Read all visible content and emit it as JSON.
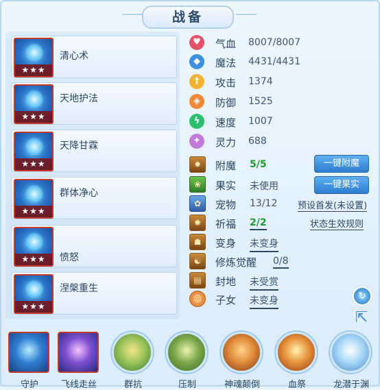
{
  "title": "战备",
  "skills": [
    {
      "name": "清心术",
      "stars": "★★★"
    },
    {
      "name": "天地护法",
      "stars": "★★★"
    },
    {
      "name": "天降甘霖",
      "stars": "★★★"
    },
    {
      "name": "群体净心",
      "stars": "★★★"
    },
    {
      "name": "愤怒",
      "stars": "★★★"
    },
    {
      "name": "涅槃重生",
      "stars": "★★★"
    }
  ],
  "stats": [
    {
      "label": "气血",
      "value": "8007/8007",
      "icon": "heart-icon",
      "color": "#e2536b"
    },
    {
      "label": "魔法",
      "value": "4431/4431",
      "icon": "mana-icon",
      "color": "#3d8fe0"
    },
    {
      "label": "攻击",
      "value": "1374",
      "icon": "sword-icon",
      "color": "#f0b331"
    },
    {
      "label": "防御",
      "value": "1525",
      "icon": "shield-icon",
      "color": "#f08a3a"
    },
    {
      "label": "速度",
      "value": "1007",
      "icon": "lightning-icon",
      "color": "#2cbf6e"
    },
    {
      "label": "灵力",
      "value": "688",
      "icon": "spirit-icon",
      "color": "#c07ad8"
    }
  ],
  "info": {
    "enchant": {
      "label": "附魔",
      "value": "5/5"
    },
    "fruit": {
      "label": "果实",
      "value": "未使用"
    },
    "pet": {
      "label": "宠物",
      "value": "13/12"
    },
    "blessing": {
      "label": "祈福",
      "value": "2/2"
    },
    "transform": {
      "label": "变身",
      "value": "未变身"
    },
    "awaken": {
      "label": "修炼觉醒",
      "value": "0/8"
    },
    "fief": {
      "label": "封地",
      "value": "未受赏"
    },
    "children": {
      "label": "子女",
      "value": "未变身"
    }
  },
  "buttons": {
    "one_click_enchant": "一键附魔",
    "one_click_fruit": "一键果实",
    "preset_lineup": "预设首发(未设置)",
    "status_rules": "状态生效规则"
  },
  "bottom_skills": [
    {
      "label": "守护"
    },
    {
      "label": "飞线走丝"
    },
    {
      "label": "群抗"
    },
    {
      "label": "压制"
    },
    {
      "label": "神魂颠倒"
    },
    {
      "label": "血祭"
    },
    {
      "label": "龙潜于渊"
    }
  ]
}
